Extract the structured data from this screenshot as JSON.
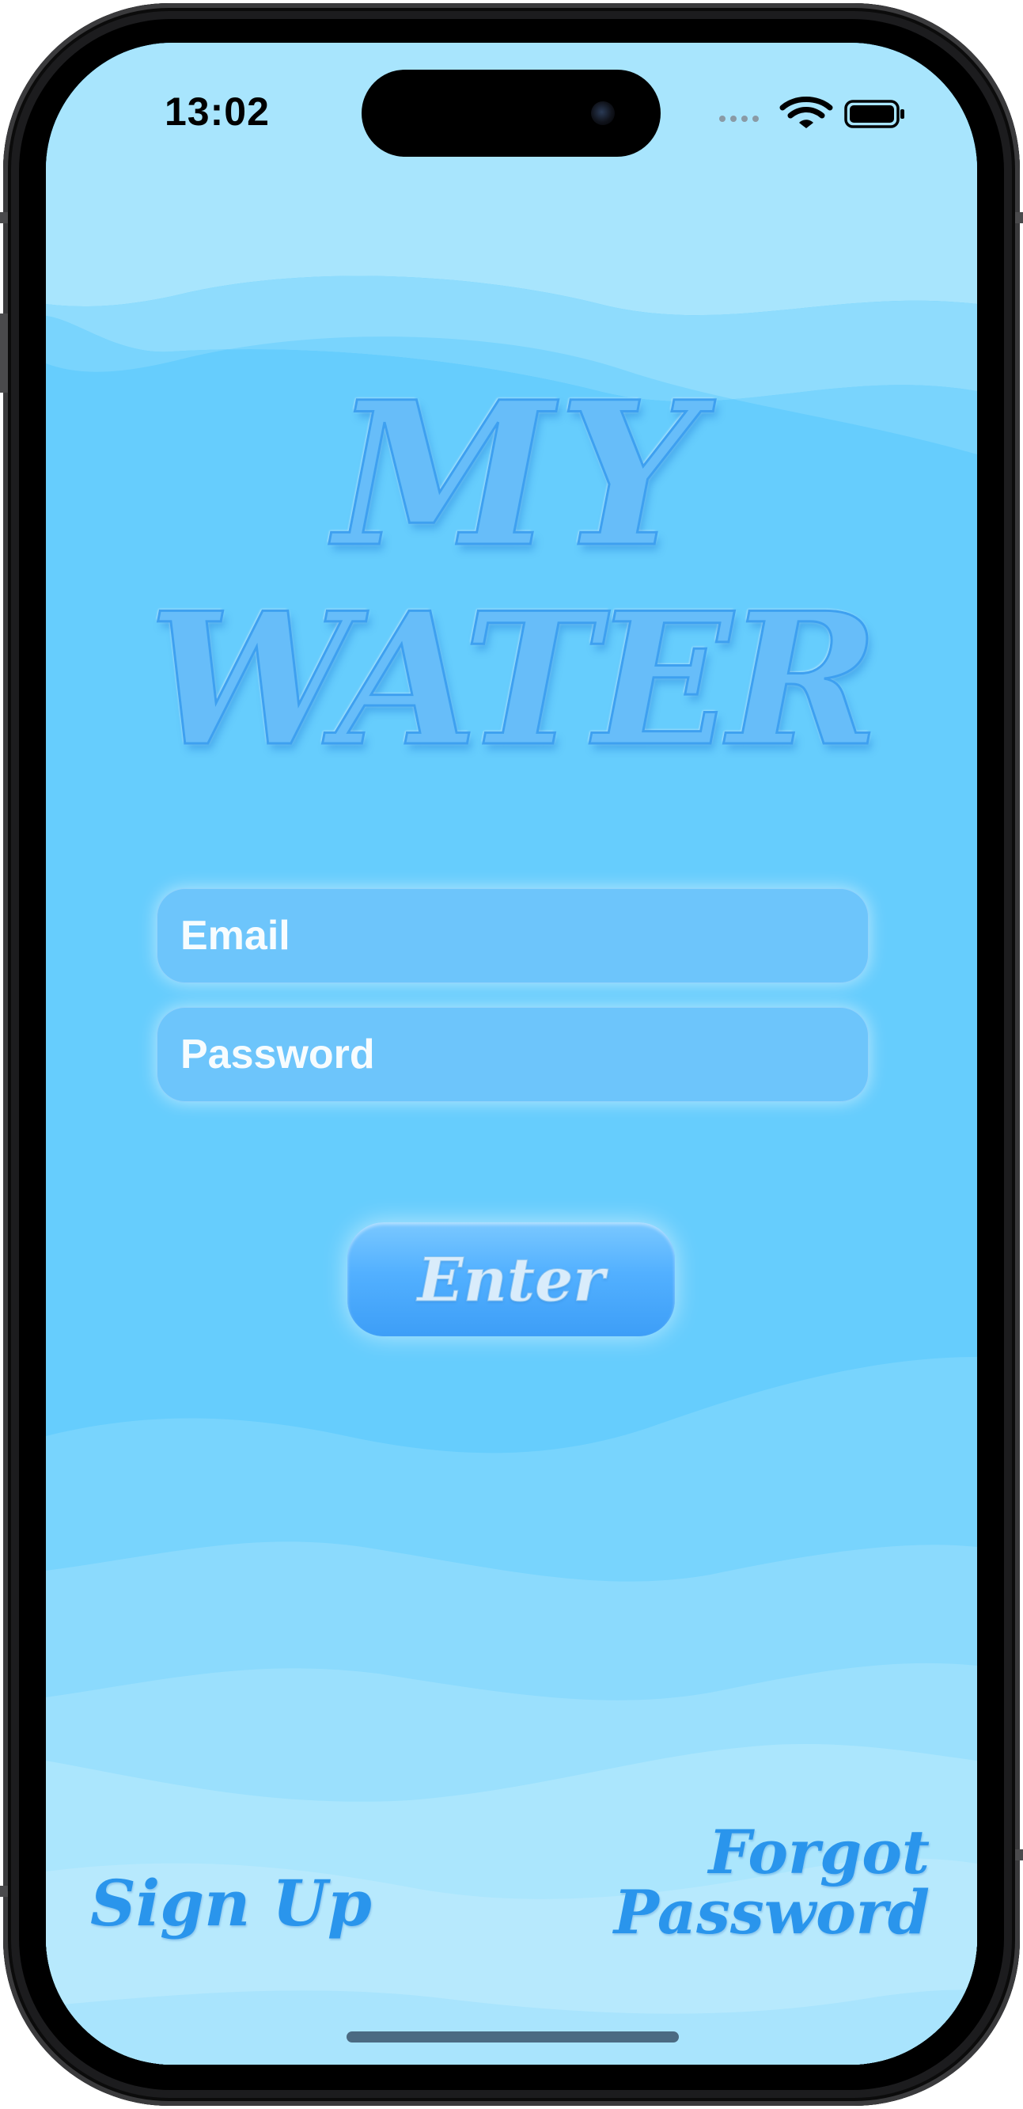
{
  "status_bar": {
    "time": "13:02",
    "icons": [
      "signal-dots-icon",
      "wifi-icon",
      "battery-icon"
    ]
  },
  "app": {
    "title_line1": "MY",
    "title_line2": "WATER"
  },
  "form": {
    "email_placeholder": "Email",
    "password_placeholder": "Password",
    "enter_label": "Enter"
  },
  "footer": {
    "sign_up_label": "Sign Up",
    "forgot_line1": "Forgot",
    "forgot_line2": "Password"
  },
  "colors": {
    "background": "#66cdfd",
    "title": "#67bdf9",
    "field": "#6dc5fb",
    "button": "#52b0ff",
    "link": "#2a95ec"
  }
}
